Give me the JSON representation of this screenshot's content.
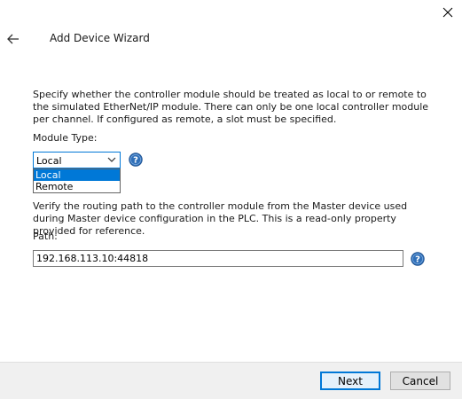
{
  "wizard": {
    "title": "Add Device Wizard"
  },
  "module_type": {
    "description": "Specify whether the controller module should be treated as local to or remote to the simulated EtherNet/IP module. There can only be one local controller module per channel. If configured as remote, a slot must be specified.",
    "label": "Module Type:",
    "selected": "Local",
    "options": [
      "Local",
      "Remote"
    ]
  },
  "path": {
    "description": "Verify the routing path to the controller module from the Master device used during Master device configuration in the PLC. This is a read-only property provided for reference.",
    "label": "Path:",
    "value": "192.168.113.10:44818"
  },
  "buttons": {
    "next": "Next",
    "cancel": "Cancel"
  },
  "icons": {
    "close": "close-icon",
    "back": "back-arrow-icon",
    "help": "help-icon",
    "chevron": "chevron-down-icon"
  },
  "colors": {
    "accent": "#0078d7",
    "help_icon_fill": "#2f6fb8",
    "footer_bg": "#f0f0f0"
  }
}
